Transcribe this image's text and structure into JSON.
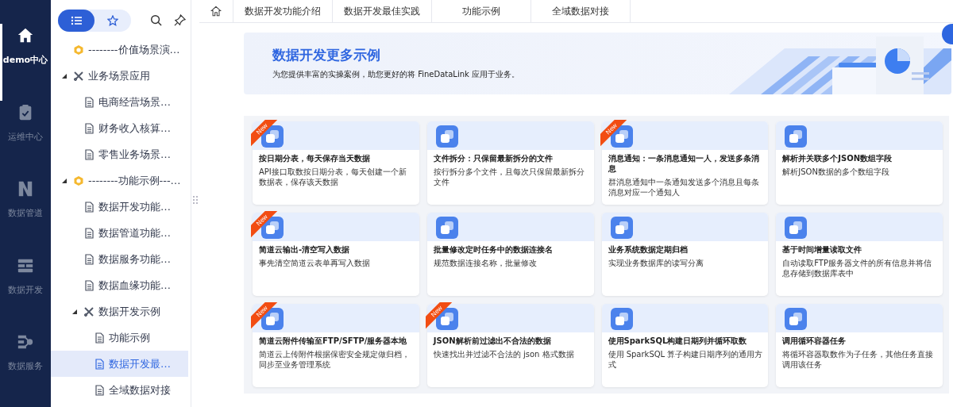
{
  "rail": [
    {
      "label": "demo中心",
      "kind": "home",
      "selected": true
    },
    {
      "label": "运维中心",
      "kind": "clipboard",
      "selected": false
    },
    {
      "label": "数据管道",
      "kind": "pipeline",
      "selected": false
    },
    {
      "label": "数据开发",
      "kind": "develop",
      "selected": false
    },
    {
      "label": "数据服务",
      "kind": "service",
      "selected": false
    }
  ],
  "tree_toolbar": {
    "views": [
      {
        "kind": "list",
        "selected": true
      },
      {
        "kind": "star",
        "selected": false
      }
    ]
  },
  "tree": [
    {
      "label": "--------价值场景演…",
      "kind": "hex",
      "selected": false
    },
    {
      "label": "业务场景应用",
      "kind": "folder",
      "expanded": true,
      "selected": false,
      "children": [
        {
          "label": "电商经营场景…",
          "kind": "doc",
          "selected": false
        },
        {
          "label": "财务收入核算…",
          "kind": "doc",
          "selected": false
        },
        {
          "label": "零售业务场景…",
          "kind": "doc",
          "selected": false
        }
      ]
    },
    {
      "label": "--------功能示例---…",
      "kind": "hex",
      "expanded": true,
      "selected": false,
      "children": [
        {
          "label": "数据开发功能…",
          "kind": "doc",
          "selected": false
        },
        {
          "label": "数据管道功能…",
          "kind": "doc",
          "selected": false
        },
        {
          "label": "数据服务功能…",
          "kind": "doc",
          "selected": false
        },
        {
          "label": "数据血缘功能…",
          "kind": "doc",
          "selected": false
        },
        {
          "label": "数据开发示例",
          "kind": "folder",
          "expanded": true,
          "selected": false,
          "children": [
            {
              "label": "功能示例",
              "kind": "doc",
              "selected": false
            },
            {
              "label": "数据开发最…",
              "kind": "doc",
              "selected": true
            },
            {
              "label": "全域数据对接",
              "kind": "doc",
              "selected": false
            }
          ]
        }
      ]
    }
  ],
  "tabs": [
    "数据开发功能介绍",
    "数据开发最佳实践",
    "功能示例",
    "全域数据对接"
  ],
  "banner": {
    "title": "数据开发更多示例",
    "subtitle": "为您提供丰富的实操案例，助您更好的将 FineDataLink 应用于业务。"
  },
  "cards": [
    {
      "title": "按日期分表，每天保存当天数据",
      "description": "API接口取数按日期分表，每天创建一个新数据表，保存该天数据",
      "badge": "New"
    },
    {
      "title": "文件拆分：只保留最新拆分的文件",
      "description": "按行拆分多个文件，且每次只保留最新拆分文件"
    },
    {
      "title": "消息通知：一条消息通知一人，发送多条消息",
      "description": "群消息通知中一条通知发送多个消息且每条消息对应一个通知人",
      "badge": "New"
    },
    {
      "title": "解析并关联多个JSON数组字段",
      "description": "解析JSON数据的多个数组字段"
    },
    {
      "title": "简道云输出-清空写入数据",
      "description": "事先清空简道云表单再写入数据",
      "badge": "New"
    },
    {
      "title": "批量修改定时任务中的数据连接名",
      "description": "规范数据连接名称，批量修改"
    },
    {
      "title": "业务系统数据定期归档",
      "description": "实现业务数据库的读写分离"
    },
    {
      "title": "基于时间增量读取文件",
      "description": "自动读取FTP服务器文件的所有信息并将信息存储到数据库表中"
    },
    {
      "title": "简道云附件传输至FTP/SFTP/服务器本地",
      "description": "简道云上传附件根据保密安全规定做归档，同步至业务管理系统",
      "badge": "New"
    },
    {
      "title": "JSON解析前过滤出不合法的数据",
      "description": "快速找出并过滤不合法的 json 格式数据",
      "badge": "New"
    },
    {
      "title": "使用SparkSQL构建日期列并循环取数",
      "description": "使用 SparkSQL 算子构建日期序列的通用方式"
    },
    {
      "title": "调用循环容器任务",
      "description": "将循环容器取数作为子任务，其他任务直接调用该任务"
    }
  ]
}
